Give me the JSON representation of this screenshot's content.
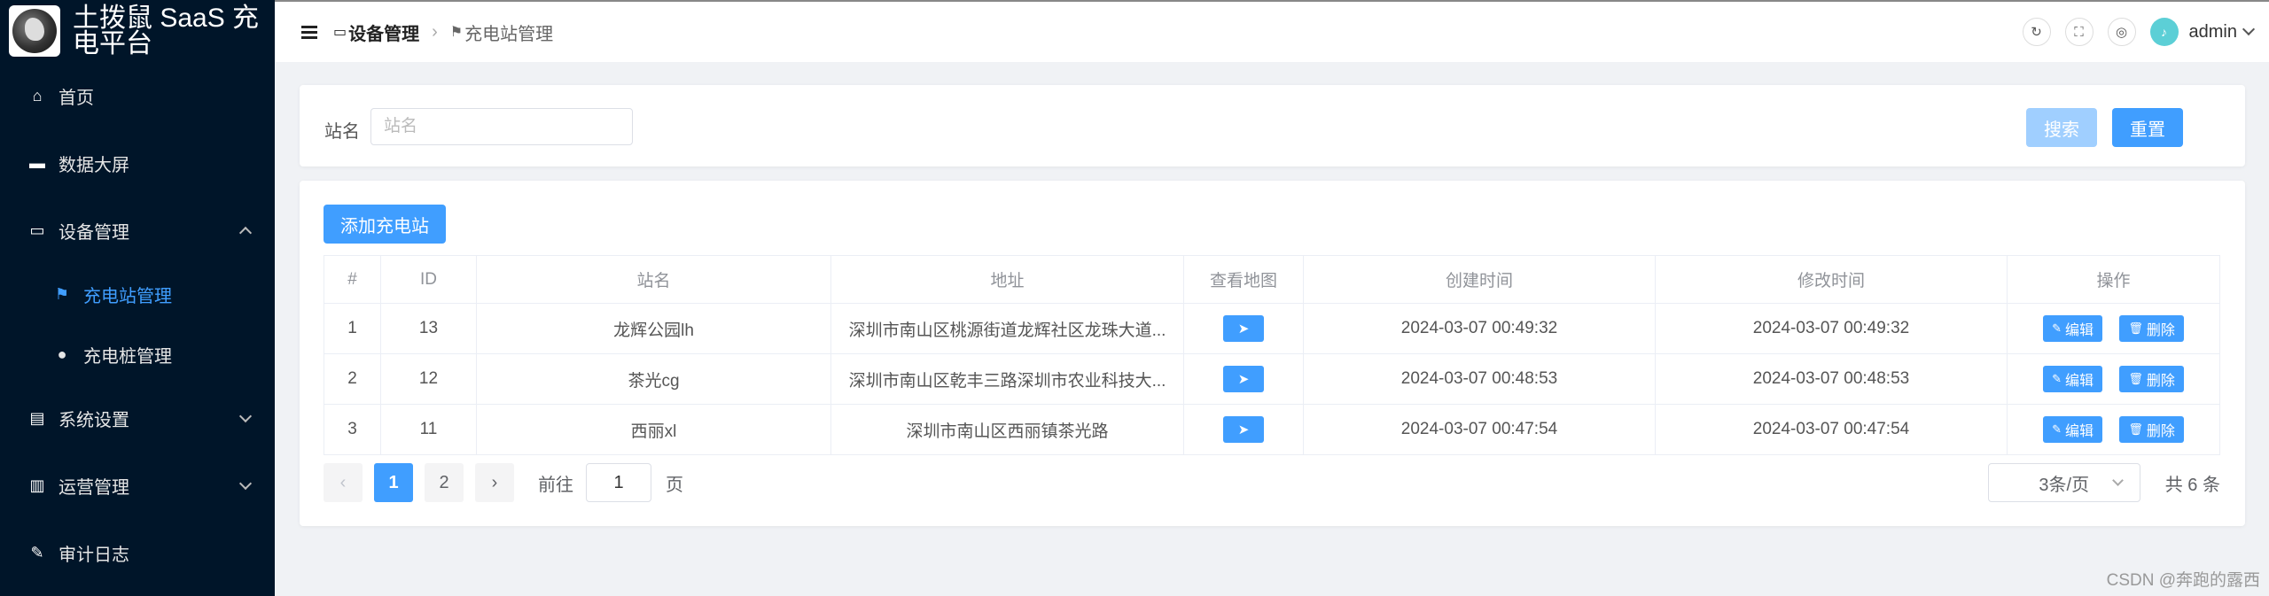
{
  "app": {
    "title": "土拨鼠 SaaS 充电平台"
  },
  "sidebar": {
    "items": [
      {
        "label": "首页",
        "icon": "home-icon"
      },
      {
        "label": "数据大屏",
        "icon": "monitor-icon"
      },
      {
        "label": "设备管理",
        "icon": "device-icon",
        "expanded": true,
        "children": [
          {
            "label": "充电站管理",
            "icon": "flag-icon",
            "active": true
          },
          {
            "label": "充电桩管理",
            "icon": "user-icon"
          }
        ]
      },
      {
        "label": "系统设置",
        "icon": "clipboard-icon"
      },
      {
        "label": "运营管理",
        "icon": "chart-icon"
      },
      {
        "label": "审计日志",
        "icon": "edit-icon"
      }
    ]
  },
  "header": {
    "breadcrumb": [
      "设备管理",
      "充电站管理"
    ],
    "user": "admin"
  },
  "search": {
    "station_label": "站名",
    "station_placeholder": "站名",
    "search_label": "搜索",
    "reset_label": "重置"
  },
  "toolbar": {
    "add_label": "添加充电站"
  },
  "table": {
    "columns": [
      "#",
      "ID",
      "站名",
      "地址",
      "查看地图",
      "创建时间",
      "修改时间",
      "操作"
    ],
    "rows": [
      {
        "idx": "1",
        "id": "13",
        "name": "龙辉公园lh",
        "address": "深圳市南山区桃源街道龙辉社区龙珠大道...",
        "created": "2024-03-07 00:49:32",
        "updated": "2024-03-07 00:49:32"
      },
      {
        "idx": "2",
        "id": "12",
        "name": "茶光cg",
        "address": "深圳市南山区乾丰三路深圳市农业科技大...",
        "created": "2024-03-07 00:48:53",
        "updated": "2024-03-07 00:48:53"
      },
      {
        "idx": "3",
        "id": "11",
        "name": "西丽xl",
        "address": "深圳市南山区西丽镇茶光路",
        "created": "2024-03-07 00:47:54",
        "updated": "2024-03-07 00:47:54"
      }
    ],
    "edit_label": "编辑",
    "delete_label": "删除"
  },
  "pagination": {
    "pages": [
      "1",
      "2"
    ],
    "current": "1",
    "goto_prefix": "前往",
    "goto_value": "1",
    "goto_suffix": "页",
    "page_size": "3条/页",
    "total": "共 6 条"
  },
  "watermark": "CSDN @奔跑的露西",
  "colors": {
    "primary": "#409eff",
    "primary_light": "#a0cfff",
    "sidebar_bg": "#001529"
  }
}
